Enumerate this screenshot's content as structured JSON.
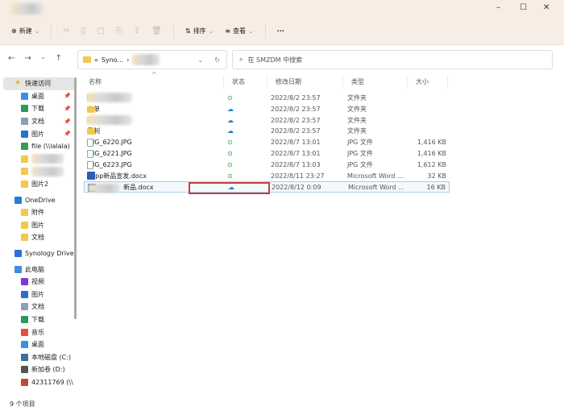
{
  "window": {
    "controls": [
      "–",
      "☐",
      "✕"
    ]
  },
  "toolbar": {
    "new": "新建",
    "sort": "排序",
    "view": "查看",
    "more": "···"
  },
  "address": {
    "path_prefix": "«",
    "path_first": "Syno...",
    "search_placeholder": "在 SMZDM 中搜索"
  },
  "sidebar": {
    "items": [
      {
        "label": "快速访问",
        "icon": "star-icon",
        "color": "#f4b400",
        "top": true,
        "sel": true
      },
      {
        "label": "桌面",
        "icon": "desktop-icon",
        "color": "#3a8ee6",
        "pin": true
      },
      {
        "label": "下载",
        "icon": "download-icon",
        "color": "#2a9a5a",
        "pin": true
      },
      {
        "label": "文档",
        "icon": "document-icon",
        "color": "#8aa0b8",
        "pin": true
      },
      {
        "label": "图片",
        "icon": "pictures-icon",
        "color": "#2a6fd6",
        "pin": true
      },
      {
        "label": "file (\\\\lalala)",
        "icon": "network-drive-icon",
        "color": "#3a9a5a"
      },
      {
        "label": "",
        "icon": "folder-icon",
        "color": "#f3c84f",
        "blur": true
      },
      {
        "label": "",
        "icon": "folder-icon",
        "color": "#f3c84f",
        "blur": true
      },
      {
        "label": "图片2",
        "icon": "folder-icon",
        "color": "#f3c84f"
      },
      {
        "label": "OneDrive",
        "icon": "cloud-icon",
        "color": "#2a7bd6",
        "top": true
      },
      {
        "label": "附件",
        "icon": "folder-icon",
        "color": "#f3c84f"
      },
      {
        "label": "图片",
        "icon": "folder-icon",
        "color": "#f3c84f"
      },
      {
        "label": "文档",
        "icon": "folder-icon",
        "color": "#f3c84f"
      },
      {
        "label": "Synology Drive",
        "icon": "synology-icon",
        "color": "#2a6fd6",
        "top": true
      },
      {
        "label": "此电脑",
        "icon": "computer-icon",
        "color": "#3a8ee6",
        "top": true
      },
      {
        "label": "视频",
        "icon": "video-icon",
        "color": "#7a3ad6"
      },
      {
        "label": "图片",
        "icon": "pictures-icon",
        "color": "#2a6fd6"
      },
      {
        "label": "文档",
        "icon": "document-icon",
        "color": "#8aa0b8"
      },
      {
        "label": "下载",
        "icon": "download-icon",
        "color": "#2a9a5a"
      },
      {
        "label": "音乐",
        "icon": "music-icon",
        "color": "#e0503a"
      },
      {
        "label": "桌面",
        "icon": "desktop-icon",
        "color": "#3a8ee6"
      },
      {
        "label": "本地磁盘 (C:)",
        "icon": "disk-icon",
        "color": "#3a6fa0"
      },
      {
        "label": "新加卷 (D:)",
        "icon": "disk-icon",
        "color": "#555555"
      },
      {
        "label": "42311769 (\\\\",
        "icon": "network-drive-icon",
        "color": "#c04a3a"
      }
    ]
  },
  "columns": {
    "name": "名称",
    "status": "状态",
    "date": "修改日期",
    "type": "类型",
    "size": "大小"
  },
  "files": [
    {
      "name": "",
      "blur": true,
      "kind": "folder",
      "status": "ok",
      "date": "2022/8/2 23:57",
      "type": "文件夹",
      "size": ""
    },
    {
      "name": "商单",
      "kind": "folder",
      "status": "cloud",
      "date": "2022/8/2 23:57",
      "type": "文件夹",
      "size": ""
    },
    {
      "name": "",
      "blur": true,
      "kind": "folder",
      "status": "cloud",
      "date": "2022/8/2 23:57",
      "type": "文件夹",
      "size": ""
    },
    {
      "name": "目制",
      "kind": "folder",
      "status": "cloud",
      "date": "2022/8/2 23:57",
      "type": "文件夹",
      "size": ""
    },
    {
      "name": "IMG_6220.JPG",
      "kind": "image",
      "status": "ok",
      "date": "2022/8/7 13:01",
      "type": "JPG 文件",
      "size": "1,416 KB"
    },
    {
      "name": "IMG_6221.JPG",
      "kind": "image",
      "status": "ok",
      "date": "2022/8/7 13:01",
      "type": "JPG 文件",
      "size": "1,416 KB"
    },
    {
      "name": "IMG_6223.JPG",
      "kind": "image",
      "status": "ok",
      "date": "2022/8/7 13:03",
      "type": "JPG 文件",
      "size": "1,612 KB"
    },
    {
      "name": "pppp新品宣发.docx",
      "kind": "word",
      "status": "ok",
      "date": "2022/8/11 23:27",
      "type": "Microsoft Word ...",
      "size": "32 KB"
    },
    {
      "name": "新品.docx",
      "blurprefix": true,
      "kind": "word",
      "status": "cloud",
      "date": "2022/8/12 0:09",
      "type": "Microsoft Word ...",
      "size": "16 KB",
      "selected": true
    }
  ],
  "statusbar": {
    "count": "9 个项目"
  }
}
